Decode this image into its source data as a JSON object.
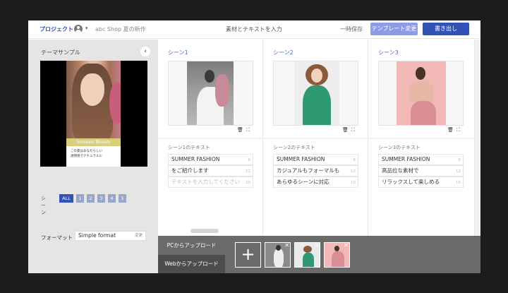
{
  "header": {
    "project_label": "プロジェクト",
    "shop_title": "abc Shop 夏の新作",
    "page_title": "素材とテキストを入力",
    "save_label": "一時保存",
    "template_button": "テンプレート変更",
    "export_button": "書き出し",
    "caret": "▾"
  },
  "theme": {
    "title": "テーマサンプル",
    "back_icon": "‹",
    "preview_band_text": "Summer Beauty",
    "preview_lines": [
      "この夏はあなたらしい",
      "透明感でナチュラルに"
    ],
    "scene_label": "シーン",
    "scene_all": "ALL",
    "scene_numbers": [
      "1",
      "2",
      "3",
      "4",
      "5"
    ],
    "format_label": "フォーマット",
    "format_value": "Simple format",
    "format_change": "変更"
  },
  "scenes": [
    {
      "title": "シーン1",
      "text_label": "シーン1のテキスト",
      "lines": [
        {
          "text": "SUMMER FASHION",
          "count": "6",
          "placeholder": false
        },
        {
          "text": "をご紹介します",
          "count": "12",
          "placeholder": false
        },
        {
          "text": "テキストを入力してください",
          "count": "20",
          "placeholder": true
        }
      ]
    },
    {
      "title": "シーン2",
      "text_label": "シーン2のテキスト",
      "lines": [
        {
          "text": "SUMMER FASHION",
          "count": "6",
          "placeholder": false
        },
        {
          "text": "カジュアルもフォーマルも",
          "count": "12",
          "placeholder": false
        },
        {
          "text": "あらゆるシーンに対応",
          "count": "10",
          "placeholder": false
        }
      ]
    },
    {
      "title": "シーン3",
      "text_label": "シーン3のテキスト",
      "lines": [
        {
          "text": "SUMMER FASHION",
          "count": "6",
          "placeholder": false
        },
        {
          "text": "高品位な素材で",
          "count": "12",
          "placeholder": false
        },
        {
          "text": "リラックスして楽しめる",
          "count": "10",
          "placeholder": false
        }
      ]
    }
  ],
  "scene_icons": {
    "trash": "🗑",
    "crop": "⛶"
  },
  "upload": {
    "pc_label": "PCからアップロード",
    "web_label": "Webからアップロード",
    "add_symbol": "+",
    "remove_symbol": "✕"
  },
  "colors": {
    "accent": "#3352b5",
    "template_button": "#8e9de3",
    "scene_title": "#4a66c8"
  }
}
